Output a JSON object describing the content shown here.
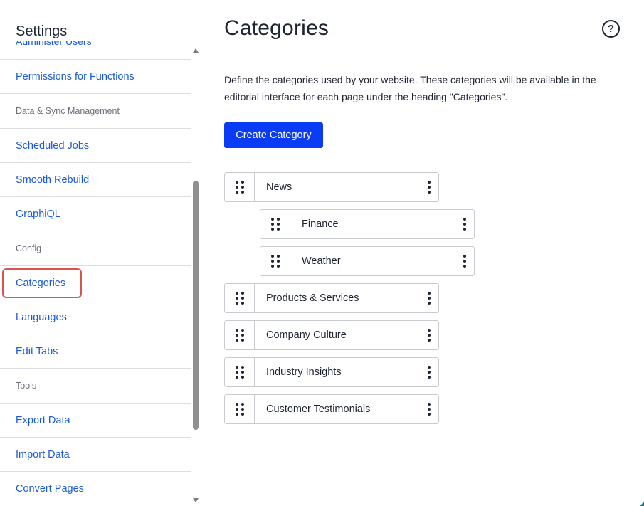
{
  "sidebar": {
    "title": "Settings",
    "cut_item": "Administer Users",
    "rows": [
      {
        "type": "link",
        "label": "Permissions for Functions",
        "name": "sidebar-item-permissions-for-functions"
      },
      {
        "type": "section",
        "label": "Data & Sync Management",
        "name": "sidebar-section-data-sync"
      },
      {
        "type": "link",
        "label": "Scheduled Jobs",
        "name": "sidebar-item-scheduled-jobs"
      },
      {
        "type": "link",
        "label": "Smooth Rebuild",
        "name": "sidebar-item-smooth-rebuild"
      },
      {
        "type": "link",
        "label": "GraphiQL",
        "name": "sidebar-item-graphiql"
      },
      {
        "type": "section",
        "label": "Config",
        "name": "sidebar-section-config"
      },
      {
        "type": "link",
        "label": "Categories",
        "name": "sidebar-item-categories",
        "highlight": true
      },
      {
        "type": "link",
        "label": "Languages",
        "name": "sidebar-item-languages"
      },
      {
        "type": "link",
        "label": "Edit Tabs",
        "name": "sidebar-item-edit-tabs"
      },
      {
        "type": "section",
        "label": "Tools",
        "name": "sidebar-section-tools"
      },
      {
        "type": "link",
        "label": "Export Data",
        "name": "sidebar-item-export-data"
      },
      {
        "type": "link",
        "label": "Import Data",
        "name": "sidebar-item-import-data"
      },
      {
        "type": "link",
        "label": "Convert Pages",
        "name": "sidebar-item-convert-pages"
      }
    ]
  },
  "main": {
    "title": "Categories",
    "help_icon": "question-circle-icon",
    "description": "Define the categories used by your website. These categories will be available in the editorial interface for each page under the heading \"Categories\".",
    "create_button": "Create Category",
    "categories": [
      {
        "label": "News",
        "level": 0
      },
      {
        "label": "Finance",
        "level": 1
      },
      {
        "label": "Weather",
        "level": 1
      },
      {
        "label": "Products & Services",
        "level": 0
      },
      {
        "label": "Company Culture",
        "level": 0
      },
      {
        "label": "Industry Insights",
        "level": 0
      },
      {
        "label": "Customer Testimonials",
        "level": 0
      }
    ]
  },
  "colors": {
    "link": "#1a5ad7",
    "primary_button": "#0a3bf5",
    "highlight_outline": "#d9534f",
    "text": "#1f2433"
  }
}
